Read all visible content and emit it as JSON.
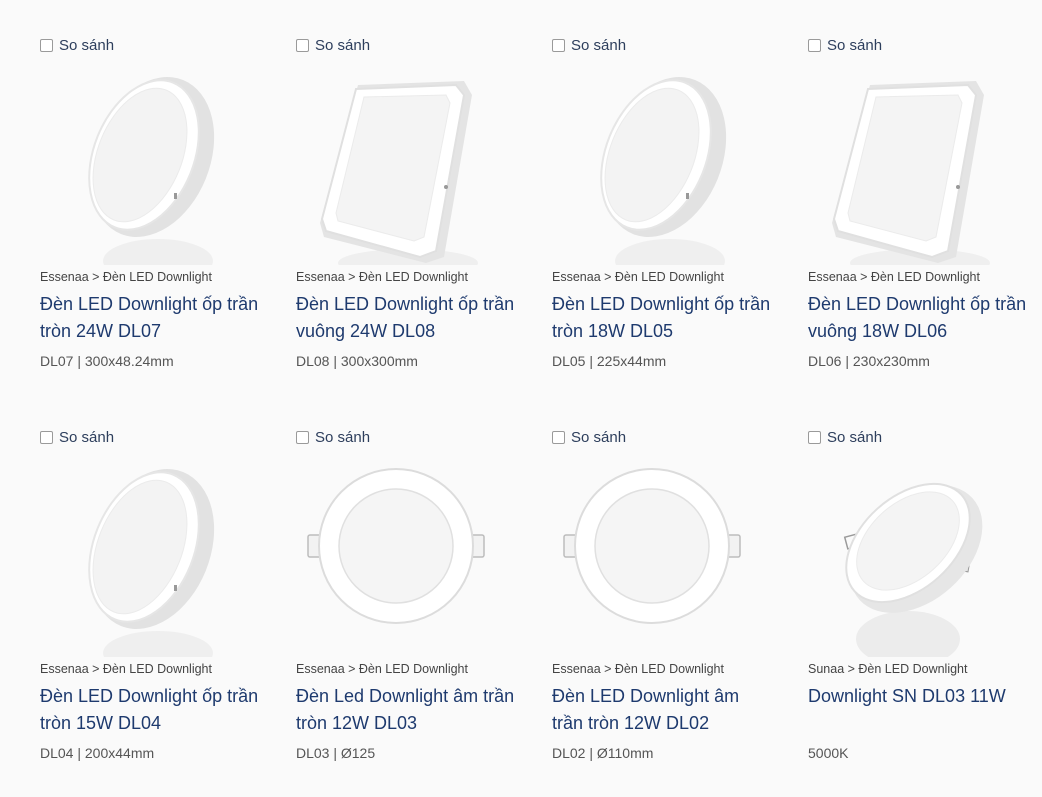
{
  "compare_label": "So sánh",
  "products": [
    {
      "breadcrumb": "Essenaa > Đèn LED Downlight",
      "title": "Đèn LED Downlight ốp trần tròn 24W DL07",
      "spec": "DL07 | 300x48.24mm",
      "shape": "surface-round"
    },
    {
      "breadcrumb": "Essenaa > Đèn LED Downlight",
      "title": "Đèn LED Downlight ốp trần vuông 24W DL08",
      "spec": "DL08 | 300x300mm",
      "shape": "surface-square"
    },
    {
      "breadcrumb": "Essenaa > Đèn LED Downlight",
      "title": "Đèn LED Downlight ốp trần tròn 18W DL05",
      "spec": "DL05 | 225x44mm",
      "shape": "surface-round"
    },
    {
      "breadcrumb": "Essenaa > Đèn LED Downlight",
      "title": "Đèn LED Downlight ốp trần vuông 18W DL06",
      "spec": "DL06 | 230x230mm",
      "shape": "surface-square"
    },
    {
      "breadcrumb": "Essenaa > Đèn LED Downlight",
      "title": "Đèn LED Downlight ốp trần tròn 15W DL04",
      "spec": "DL04 | 200x44mm",
      "shape": "surface-round"
    },
    {
      "breadcrumb": "Essenaa > Đèn LED Downlight",
      "title": "Đèn Led Downlight âm trần tròn 12W DL03",
      "spec": "DL03 | Ø125",
      "shape": "recessed-round"
    },
    {
      "breadcrumb": "Essenaa > Đèn LED Downlight",
      "title": "Đèn LED Downlight âm trần tròn 12W DL02",
      "spec": "DL02 | Ø110mm",
      "shape": "recessed-round"
    },
    {
      "breadcrumb": "Sunaa > Đèn LED Downlight",
      "title": "Downlight SN DL03 11W",
      "spec": "5000K",
      "shape": "recessed-angled"
    }
  ]
}
